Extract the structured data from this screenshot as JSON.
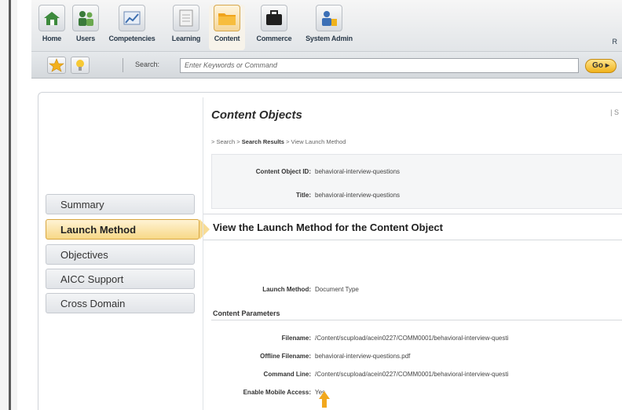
{
  "nav": {
    "items": [
      {
        "label": "Home",
        "icon": "home-icon"
      },
      {
        "label": "Users",
        "icon": "users-icon"
      },
      {
        "label": "Competencies",
        "icon": "competencies-icon"
      },
      {
        "label": "Learning",
        "icon": "learning-icon"
      },
      {
        "label": "Content",
        "icon": "folder-icon"
      },
      {
        "label": "Commerce",
        "icon": "briefcase-icon"
      },
      {
        "label": "System Admin",
        "icon": "system-admin-icon"
      }
    ],
    "right_letter": "R"
  },
  "search": {
    "label": "Search:",
    "placeholder": "Enter Keywords or Command",
    "go_label": "Go ▸"
  },
  "side_tabs": [
    {
      "label": "Summary"
    },
    {
      "label": "Launch Method"
    },
    {
      "label": "Objectives"
    },
    {
      "label": "AICC Support"
    },
    {
      "label": "Cross Domain"
    }
  ],
  "content": {
    "title": "Content Objects",
    "title_right": "| S",
    "breadcrumb": {
      "part1": "> Search > ",
      "part2": "Search Results",
      "part3": " > View Launch Method"
    },
    "object_id_label": "Content Object ID:",
    "object_id_value": "behavioral-interview-questions",
    "title_label": "Title:",
    "title_value": "behavioral-interview-questions",
    "section_title": "View the Launch Method for the Content Object",
    "launch_method_label": "Launch Method:",
    "launch_method_value": "Document Type",
    "params_heading": "Content Parameters",
    "filename_label": "Filename:",
    "filename_value": "/Content/scupload/acein0227/COMM0001/behavioral-interview-questi",
    "offline_label": "Offline Filename:",
    "offline_value": "behavioral-interview-questions.pdf",
    "command_label": "Command Line:",
    "command_value": "/Content/scupload/acein0227/COMM0001/behavioral-interview-questi",
    "mobile_label": "Enable Mobile Access:",
    "mobile_value": "Yes"
  },
  "colors": {
    "active_tab": "#f7d887",
    "go_button": "#f0b21c",
    "arrow": "#f2a81d"
  }
}
